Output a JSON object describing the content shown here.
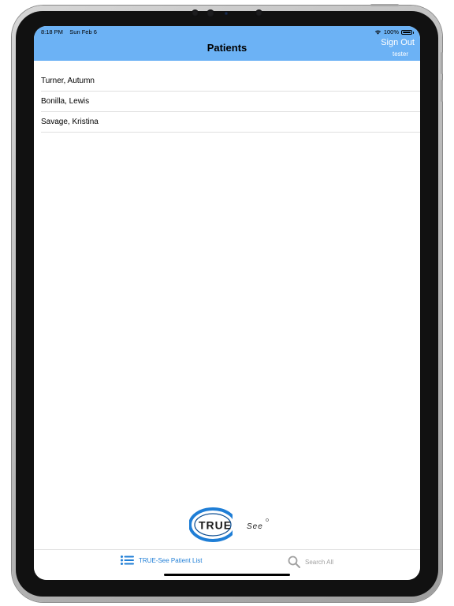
{
  "status_bar": {
    "time": "8:18 PM",
    "date": "Sun Feb 6",
    "battery": "100%"
  },
  "nav": {
    "title": "Patients",
    "sign_out_label": "Sign Out",
    "username": "tester"
  },
  "patients": [
    {
      "name": "Turner, Autumn"
    },
    {
      "name": "Bonilla, Lewis"
    },
    {
      "name": "Savage, Kristina"
    }
  ],
  "logo": {
    "main_text": "TRUE",
    "sub_text": "See"
  },
  "tabbar": {
    "tabs": [
      {
        "label": "TRUE-See Patient List",
        "icon": "list-icon",
        "selected": true
      },
      {
        "label": "Search All",
        "icon": "search-icon",
        "selected": false
      }
    ]
  },
  "colors": {
    "nav_background": "#6cb2f5",
    "tab_selected": "#1f7ed6",
    "tab_unselected": "#a0a0a0",
    "logo_blue": "#1f7ed6"
  }
}
